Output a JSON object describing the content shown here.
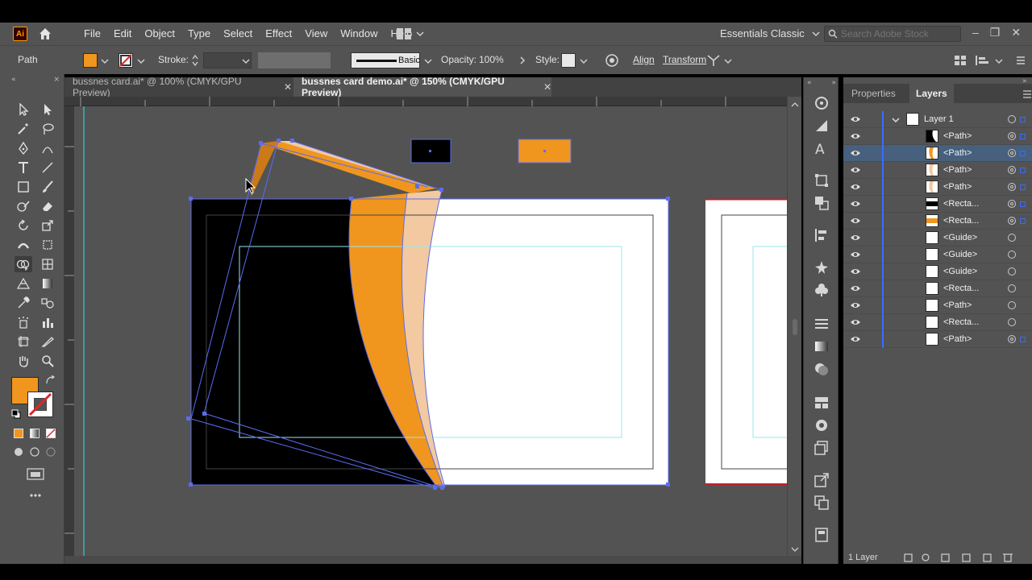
{
  "app": {
    "logo": "Ai",
    "accent": "#ff9a00"
  },
  "menu": [
    "File",
    "Edit",
    "Object",
    "Type",
    "Select",
    "Effect",
    "View",
    "Window",
    "Help"
  ],
  "workspace": {
    "name": "Essentials Classic"
  },
  "search": {
    "placeholder": "Search Adobe Stock"
  },
  "control_bar": {
    "selection": "Path",
    "fill_color": "#f0961e",
    "stroke_label": "Stroke:",
    "brush": "Basic",
    "opacity_label": "Opacity:",
    "opacity_value": "100%",
    "style_label": "Style:",
    "align": "Align",
    "transform": "Transform"
  },
  "doc_tabs": [
    {
      "label": "bussnes card.ai* @ 100% (CMYK/GPU Preview)",
      "active": false
    },
    {
      "label": "bussnes card demo.ai* @ 150% (CMYK/GPU Preview)",
      "active": true
    }
  ],
  "tools": {
    "fill_color": "#f0961e"
  },
  "layers_panel": {
    "tabs": [
      "Properties",
      "Layers"
    ],
    "active_tab": "Layers",
    "layer_name": "Layer 1",
    "items": [
      {
        "name": "<Path>",
        "thumb": "black-orange",
        "selected": false,
        "targeted": true
      },
      {
        "name": "<Path>",
        "thumb": "orange",
        "selected": true,
        "targeted": true
      },
      {
        "name": "<Path>",
        "thumb": "peach",
        "selected": false,
        "targeted": true
      },
      {
        "name": "<Path>",
        "thumb": "peach",
        "selected": false,
        "targeted": true
      },
      {
        "name": "<Recta...",
        "thumb": "black-bar",
        "selected": false,
        "targeted": true
      },
      {
        "name": "<Recta...",
        "thumb": "orange-bar",
        "selected": false,
        "targeted": true
      },
      {
        "name": "<Guide>",
        "thumb": "white",
        "selected": false,
        "targeted": false
      },
      {
        "name": "<Guide>",
        "thumb": "white",
        "selected": false,
        "targeted": false
      },
      {
        "name": "<Guide>",
        "thumb": "white",
        "selected": false,
        "targeted": false
      },
      {
        "name": "<Recta...",
        "thumb": "white",
        "selected": false,
        "targeted": false
      },
      {
        "name": "<Path>",
        "thumb": "white",
        "selected": false,
        "targeted": false
      },
      {
        "name": "<Recta...",
        "thumb": "white",
        "selected": false,
        "targeted": false
      },
      {
        "name": "<Path>",
        "thumb": "white",
        "selected": false,
        "targeted": true
      }
    ],
    "footer": "1 Layer"
  },
  "colors": {
    "orange": "#f0961e",
    "peach": "#f2c9a0",
    "selection_blue": "#5a6cf0",
    "guide_cyan": "#7fe6f0"
  }
}
